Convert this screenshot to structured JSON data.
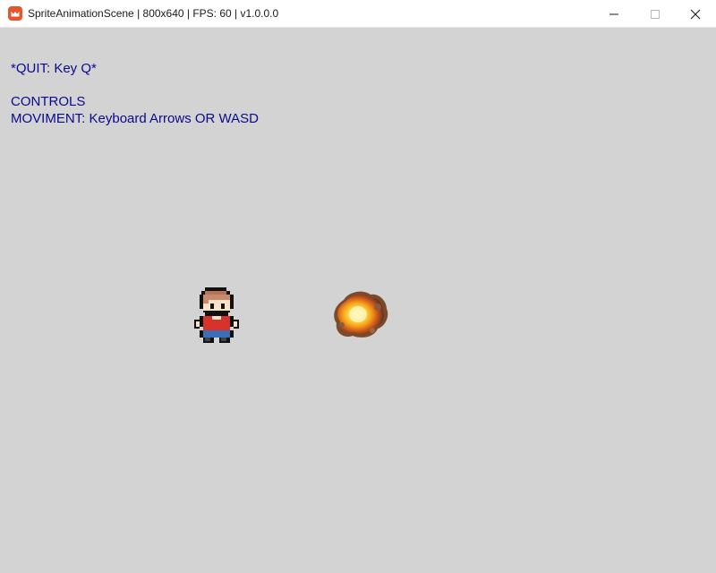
{
  "window": {
    "title": "SpriteAnimationScene | 800x640 | FPS: 60 | v1.0.0.0",
    "icon": "monogame-logo-icon",
    "controls": [
      "minimize-icon",
      "maximize-icon",
      "close-icon"
    ]
  },
  "hud": {
    "quit_text": "*QUIT: Key Q*",
    "controls_heading": "CONTROLS",
    "movement_text": "MOVIMENT: Keyboard Arrows OR WASD",
    "text_color": "#0a0a8c"
  },
  "scene": {
    "background_color": "#d3d3d3",
    "sprites": [
      "player-character-sprite",
      "explosion-sprite"
    ]
  }
}
